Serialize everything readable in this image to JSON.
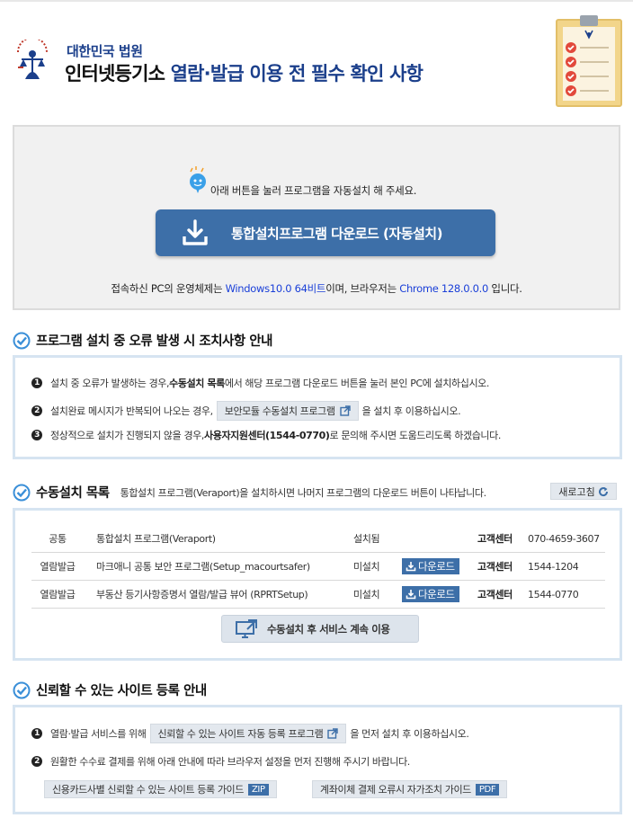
{
  "header": {
    "court_name": "대한민국 법원",
    "title_part1": "인터넷등기소",
    "title_part2": " 열람·발급 이용 전 필수 확인 사항"
  },
  "install": {
    "message": "아래 버튼을 눌러 프로그램을 자동설치 해 주세요.",
    "button_label": "통합설치프로그램 다운로드 (자동설치)",
    "env_prefix": "접속하신 PC의 운영체제는 ",
    "os_value": "Windows10.0 64비트",
    "env_middle": "이며, 브라우저는 ",
    "browser_value": "Chrome 128.0.0.0",
    "env_suffix": " 입니다."
  },
  "error_section": {
    "title": "프로그램 설치 중 오류 발생 시 조치사항 안내",
    "step1_prefix": "설치 중 오류가 발생하는 경우, ",
    "step1_bold": "수동설치 목록",
    "step1_suffix": "에서 해당 프로그램 다운로드 버튼을 눌러 본인 PC에 설치하십시오.",
    "step2_prefix": "설치완료 메시지가 반복되어 나오는 경우,",
    "step2_button": "보안모듈 수동설치 프로그램",
    "step2_suffix": "을 설치 후 이용하십시오.",
    "step3_prefix": "정상적으로 설치가 진행되지 않을 경우, ",
    "step3_bold": "사용자지원센터(1544-0770)",
    "step3_suffix": "로 문의해 주시면 도움드리도록 하겠습니다."
  },
  "manual_section": {
    "title": "수동설치 목록",
    "description": "통합설치 프로그램(Veraport)을 설치하시면 나머지 프로그램의 다운로드 버튼이 나타납니다.",
    "refresh_label": "새로고침",
    "rows": [
      {
        "category": "공통",
        "program": "통합설치 프로그램(Veraport)",
        "status": "설치됨",
        "action": "",
        "center_label": "고객센터",
        "phone": "070-4659-3607"
      },
      {
        "category": "열람발급",
        "program": "마크애니 공통 보안 프로그램(Setup_macourtsafer)",
        "status": "미설치",
        "action": "다운로드",
        "center_label": "고객센터",
        "phone": "1544-1204"
      },
      {
        "category": "열람발급",
        "program": "부동산 등기사항증명서 열람/발급 뷰어 (RPRTSetup)",
        "status": "미설치",
        "action": "다운로드",
        "center_label": "고객센터",
        "phone": "1544-0770"
      }
    ],
    "continue_label": "수동설치 후 서비스 계속 이용"
  },
  "trusted_section": {
    "title": "신뢰할 수 있는 사이트 등록 안내",
    "step1_prefix": "열람·발급 서비스를 위해",
    "step1_button": "신뢰할 수 있는 사이트 자동 등록 프로그램",
    "step1_suffix": "을 먼저 설치 후 이용하십시오.",
    "step2": "원활한 수수료 결제를 위해 아래 안내에 따라 브라우저 설정을 먼저 진행해 주시기 바랍니다.",
    "guide1_label": "신용카드사별 신뢰할 수 있는 사이트 등록 가이드",
    "guide1_tag": "ZIP",
    "guide2_label": "계좌이체 결제 오류시 자가조치 가이드",
    "guide2_tag": "PDF"
  },
  "colors": {
    "accent_blue": "#3d6fa8",
    "title_blue": "#1b3f8b",
    "value_blue": "#1a3fd8",
    "panel_border": "#d6e4f1"
  }
}
